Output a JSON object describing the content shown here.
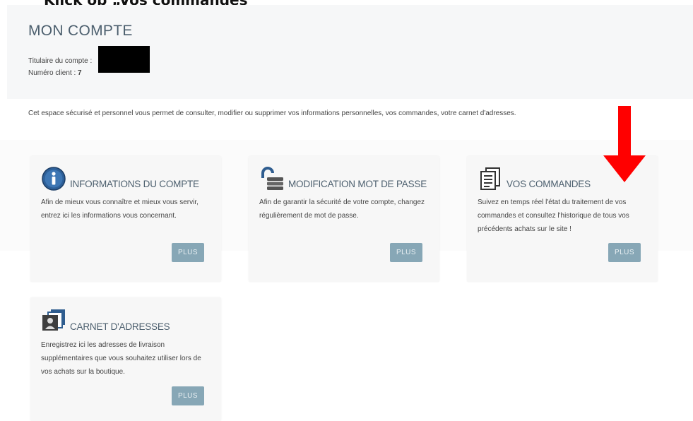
{
  "caption": "Klick op „Vos commandes”",
  "header": {
    "title": "MON COMPTE",
    "holder_label": "Titulaire du compte :",
    "client_label": "Numéro client :",
    "client_number": "7"
  },
  "intro": "Cet espace sécurisé et personnel vous permet de consulter, modifier ou supprimer vos informations personnelles, vos commandes, votre carnet d'adresses.",
  "cards": [
    {
      "icon": "info-icon",
      "title": "INFORMATIONS DU COMPTE",
      "description": "Afin de mieux vous connaître et mieux vous servir, entrez ici les informations vous concernant.",
      "button": "PLUS"
    },
    {
      "icon": "padlock-icon",
      "title": "MODIFICATION MOT DE PASSE",
      "description": "Afin de garantir la sécurité de votre compte, changez régulièrement de mot de passe.",
      "button": "PLUS"
    },
    {
      "icon": "documents-icon",
      "title": "VOS COMMANDES",
      "description": "Suivez en temps réel l'état du traitement de vos commandes et consultez l'historique de tous vos précédents achats sur le site !",
      "button": "PLUS"
    },
    {
      "icon": "address-book-icon",
      "title": "CARNET D'ADRESSES",
      "description": "Enregistrez ici les adresses de livraison supplémentaires que vous souhaitez utiliser lors de vos achats sur la boutique.",
      "button": "PLUS"
    }
  ],
  "colors": {
    "accent": "#87a7b6",
    "title_text": "#4c5f6e",
    "arrow": "#ff0000",
    "card_background": "#f7f7f7"
  }
}
